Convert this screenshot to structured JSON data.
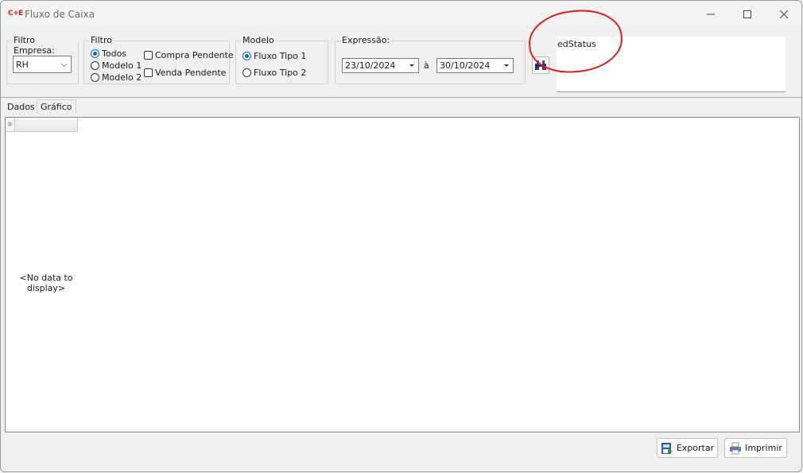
{
  "window": {
    "title": "Fluxo de Caixa",
    "logo_text": "C+E",
    "controls": [
      "minimize",
      "maximize",
      "close"
    ]
  },
  "empresa": {
    "label": "Filtro Empresa:",
    "value": "RH"
  },
  "filtro": {
    "label": "Filtro",
    "radios": [
      {
        "label": "Todos",
        "checked": true
      },
      {
        "label": "Modelo 1",
        "checked": false
      },
      {
        "label": "Modelo 2",
        "checked": false
      }
    ],
    "checks": [
      {
        "label": "Compra Pendente",
        "checked": false
      },
      {
        "label": "Venda Pendente",
        "checked": false
      }
    ]
  },
  "modelo": {
    "label": "Modelo",
    "radios": [
      {
        "label": "Fluxo Tipo 1",
        "checked": true
      },
      {
        "label": "Fluxo Tipo 2",
        "checked": false
      }
    ]
  },
  "expressao": {
    "label": "Expressão:",
    "date_from": "23/10/2024",
    "separator": "à",
    "date_to": "30/10/2024"
  },
  "status": {
    "text": "edStatus"
  },
  "tabs": [
    {
      "label": "Dados",
      "active": true
    },
    {
      "label": "Gráfico",
      "active": false
    }
  ],
  "grid": {
    "indicator": "❊",
    "no_data_line1": "<No data to",
    "no_data_line2": "display>"
  },
  "buttons": {
    "export": "Exportar",
    "print": "Imprimir"
  },
  "colors": {
    "accent": "#0a64c8",
    "annotation": "#e01b1b",
    "logo": "#d32020"
  }
}
